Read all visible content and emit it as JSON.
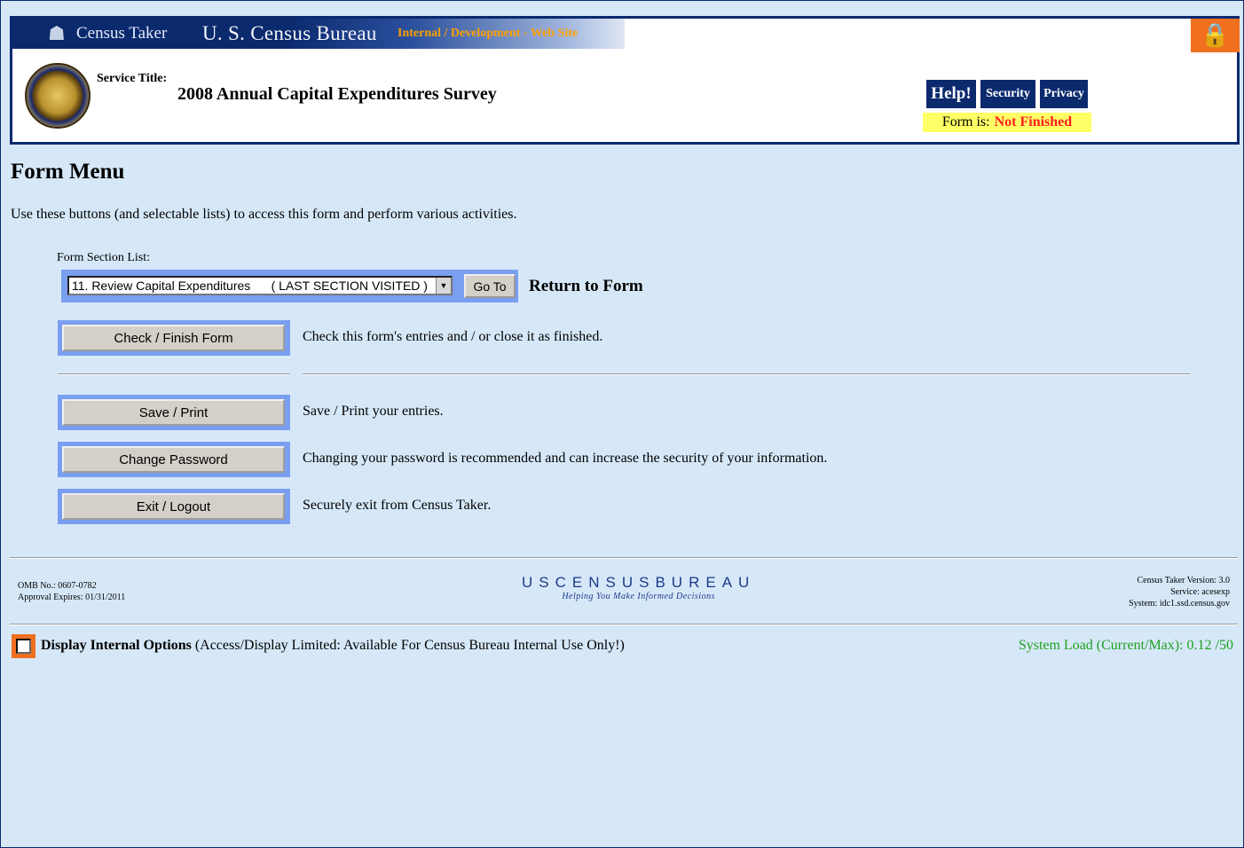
{
  "header": {
    "app_name": "Census Taker",
    "bureau": "U. S. Census Bureau",
    "site_type": "Internal / Development - Web Site",
    "service_label": "Service Title:",
    "service_title": "2008 Annual Capital Expenditures Survey",
    "buttons": {
      "help": "Help!",
      "security": "Security",
      "privacy": "Privacy"
    },
    "form_status_label": "Form is:",
    "form_status_value": "Not Finished",
    "colors": {
      "navy": "#0b2a6e",
      "accent_orange": "#f07020",
      "status_bg": "#ffff66",
      "status_red": "#ff2020"
    }
  },
  "main": {
    "title": "Form Menu",
    "intro": "Use these buttons (and selectable lists) to access this form and perform various activities.",
    "form_section_label": "Form Section List:",
    "selected_section": "11. Review Capital Expenditures      ( LAST SECTION VISITED )",
    "goto_label": "Go To",
    "return_label": "Return to Form",
    "actions": [
      {
        "label": "Check / Finish Form",
        "desc": "Check this form's entries and / or close it as finished."
      },
      {
        "label": "Save / Print",
        "desc": "Save / Print your entries."
      },
      {
        "label": "Change Password",
        "desc": "Changing your password is recommended and can increase the security of your information."
      },
      {
        "label": "Exit / Logout",
        "desc": "Securely exit from Census Taker."
      }
    ]
  },
  "footer": {
    "omb_no": "OMB No.: 0607-0782",
    "approval": "Approval Expires: 01/31/2011",
    "logo_text": "USCENSUSBUREAU",
    "logo_tagline": "Helping You Make Informed Decisions",
    "version": "Census Taker Version: 3.0",
    "service": "Service: acesexp",
    "system": "System: idc1.ssd.census.gov",
    "internal_options_label": "Display Internal Options",
    "internal_options_note": "(Access/Display Limited: Available For Census Bureau Internal Use Only!)",
    "system_load": "System Load (Current/Max): 0.12 /50"
  }
}
